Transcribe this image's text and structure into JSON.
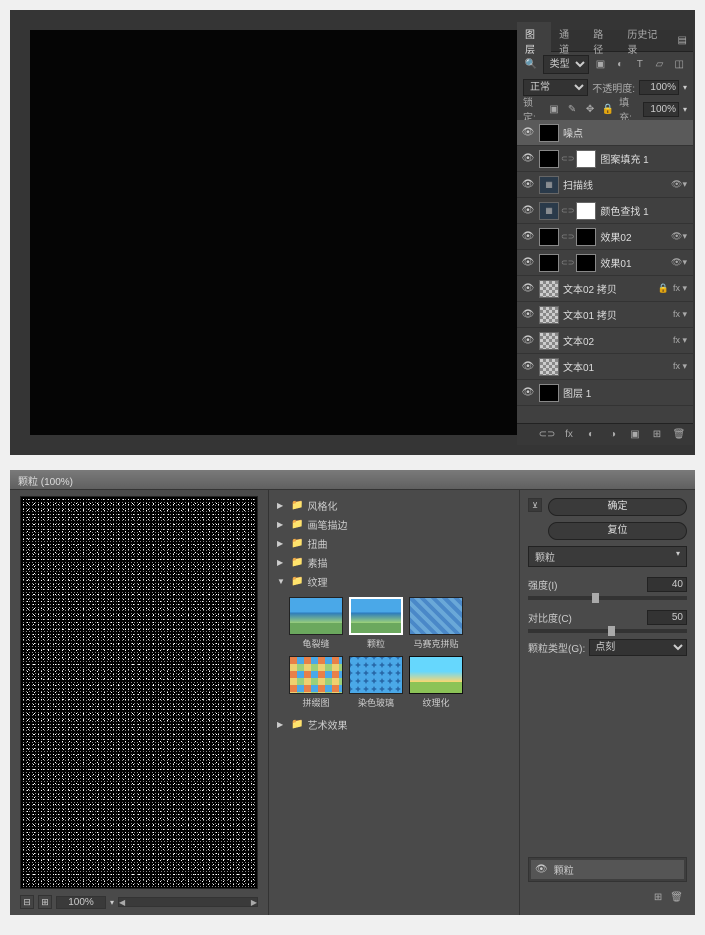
{
  "top": {
    "tabs": {
      "layers": "图层",
      "channels": "通道",
      "paths": "路径",
      "history": "历史记录"
    },
    "filterType": "类型",
    "blendMode": "正常",
    "opacityLabel": "不透明度:",
    "opacityValue": "100%",
    "lockLabel": "锁定:",
    "fillLabel": "填充:",
    "fillValue": "100%",
    "layers": [
      {
        "name": "噪点",
        "selected": true,
        "thumbs": [
          "black"
        ],
        "fx": false
      },
      {
        "name": "图案填充 1",
        "thumbs": [
          "black",
          "link",
          "white"
        ],
        "fx": false
      },
      {
        "name": "扫描线",
        "thumbs": [
          "icon"
        ],
        "fx": false,
        "collapse": true
      },
      {
        "name": "颜色查找 1",
        "thumbs": [
          "icon",
          "link",
          "white"
        ],
        "fx": false
      },
      {
        "name": "效果02",
        "thumbs": [
          "black",
          "link",
          "black"
        ],
        "fx": false,
        "collapse": true
      },
      {
        "name": "效果01",
        "thumbs": [
          "black",
          "link",
          "black"
        ],
        "fx": false,
        "collapse": true
      },
      {
        "name": "文本02 拷贝",
        "thumbs": [
          "checker"
        ],
        "fx": true,
        "lock": true
      },
      {
        "name": "文本01 拷贝",
        "thumbs": [
          "checker"
        ],
        "fx": true
      },
      {
        "name": "文本02",
        "thumbs": [
          "checker"
        ],
        "fx": true
      },
      {
        "name": "文本01",
        "thumbs": [
          "checker"
        ],
        "fx": true
      },
      {
        "name": "图层 1",
        "thumbs": [
          "black"
        ],
        "fx": false
      }
    ],
    "footerIcons": [
      "⊂⊃",
      "fx",
      "◐",
      "◑",
      "▣",
      "⊞",
      "🗑"
    ]
  },
  "filter": {
    "windowTitle": "颗粒 (100%)",
    "zoom": "100%",
    "categories": [
      {
        "label": "风格化",
        "open": false
      },
      {
        "label": "画笔描边",
        "open": false
      },
      {
        "label": "扭曲",
        "open": false
      },
      {
        "label": "素描",
        "open": false
      },
      {
        "label": "纹理",
        "open": true
      },
      {
        "label": "艺术效果",
        "open": false
      }
    ],
    "textureItems": [
      {
        "label": "龟裂缝",
        "cls": ""
      },
      {
        "label": "颗粒",
        "cls": "selected"
      },
      {
        "label": "马赛克拼贴",
        "cls": "mosaic"
      },
      {
        "label": "拼缀图",
        "cls": "patch"
      },
      {
        "label": "染色玻璃",
        "cls": "glass"
      },
      {
        "label": "纹理化",
        "cls": "tex"
      }
    ],
    "okBtn": "确定",
    "resetBtn": "复位",
    "filterName": "颗粒",
    "intensityLabel": "强度(I)",
    "intensityValue": "40",
    "contrastLabel": "对比度(C)",
    "contrastValue": "50",
    "grainTypeLabel": "颗粒类型(G):",
    "grainTypeValue": "点刻",
    "effectLayerName": "颗粒"
  }
}
